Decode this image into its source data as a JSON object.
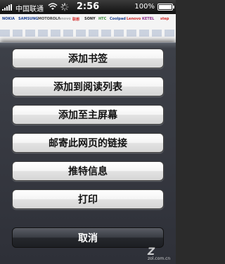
{
  "status_bar": {
    "carrier": "中国联通",
    "time": "2:56",
    "battery_percent": "100%",
    "battery_level": 1.0
  },
  "background_page": {
    "logos": [
      "NOKIA",
      "SAMSUNG",
      "MOTOROLA",
      "lenovo",
      "联想",
      "SONY",
      "HTC",
      "Coolpad",
      "Lenovo",
      "KETEL",
      "step"
    ]
  },
  "action_sheet": {
    "items": [
      "添加书签",
      "添加到阅读列表",
      "添加至主屏幕",
      "邮寄此网页的链接",
      "推特信息",
      "打印"
    ],
    "cancel_label": "取消"
  },
  "watermark": {
    "mark": "Z",
    "text": "zol.com.cn"
  }
}
